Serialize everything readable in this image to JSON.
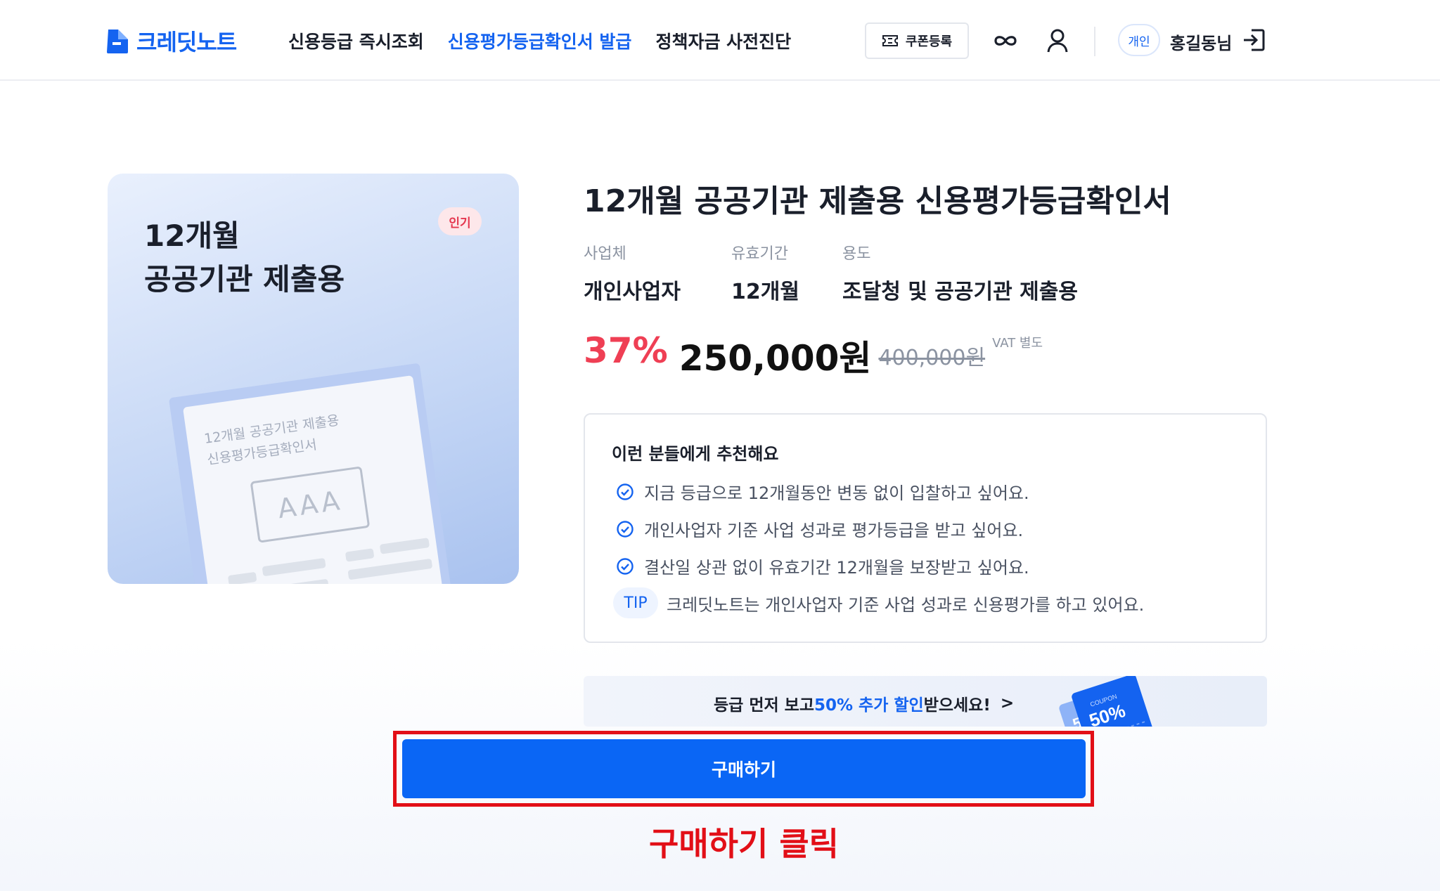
{
  "header": {
    "logo_text": "크레딧노트",
    "nav": [
      "신용등급 즉시조회",
      "신용평가등급확인서 발급",
      "정책자금 사전진단"
    ],
    "coupon_label": "쿠폰등록",
    "personal_badge": "개인",
    "username": "홍길동님"
  },
  "card": {
    "title_line1": "12개월",
    "title_line2": "공공기관 제출용",
    "badge": "인기",
    "doc_line1": "12개월 공공기관 제출용",
    "doc_line2": "신용평가등급확인서",
    "doc_grade": "AAA"
  },
  "product": {
    "title": "12개월 공공기관 제출용 신용평가등급확인서",
    "specs": [
      {
        "label": "사업체",
        "value": "개인사업자"
      },
      {
        "label": "유효기간",
        "value": "12개월"
      },
      {
        "label": "용도",
        "value": "조달청 및 공공기관 제출용"
      }
    ],
    "discount": "37%",
    "price": "250,000원",
    "original_price": "400,000원",
    "vat_note": "VAT 별도"
  },
  "recommend": {
    "title": "이런 분들에게 추천해요",
    "items": [
      "지금 등급으로 12개월동안 변동 없이 입찰하고 싶어요.",
      "개인사업자 기준 사업 성과로 평가등급을 받고 싶어요.",
      "결산일 상관 없이 유효기간 12개월을 보장받고 싶어요."
    ],
    "tip_label": "TIP",
    "tip_text": "크레딧노트는 개인사업자 기준 사업 성과로 신용평가를 하고 있어요."
  },
  "promo": {
    "text_before": "등급 먼저 보고 ",
    "highlight": "50% 추가 할인",
    "text_after": " 받으세요!",
    "chevron": ">",
    "coupon_small": "COUPON",
    "coupon_value": "50%",
    "coupon_back_digit": "5"
  },
  "buy_button": "구매하기",
  "annotation": "구매하기 클릭",
  "colors": {
    "brand": "#1463f0",
    "discount": "#ef3f54",
    "button": "#0a66f5",
    "annotation": "#e20f17"
  }
}
